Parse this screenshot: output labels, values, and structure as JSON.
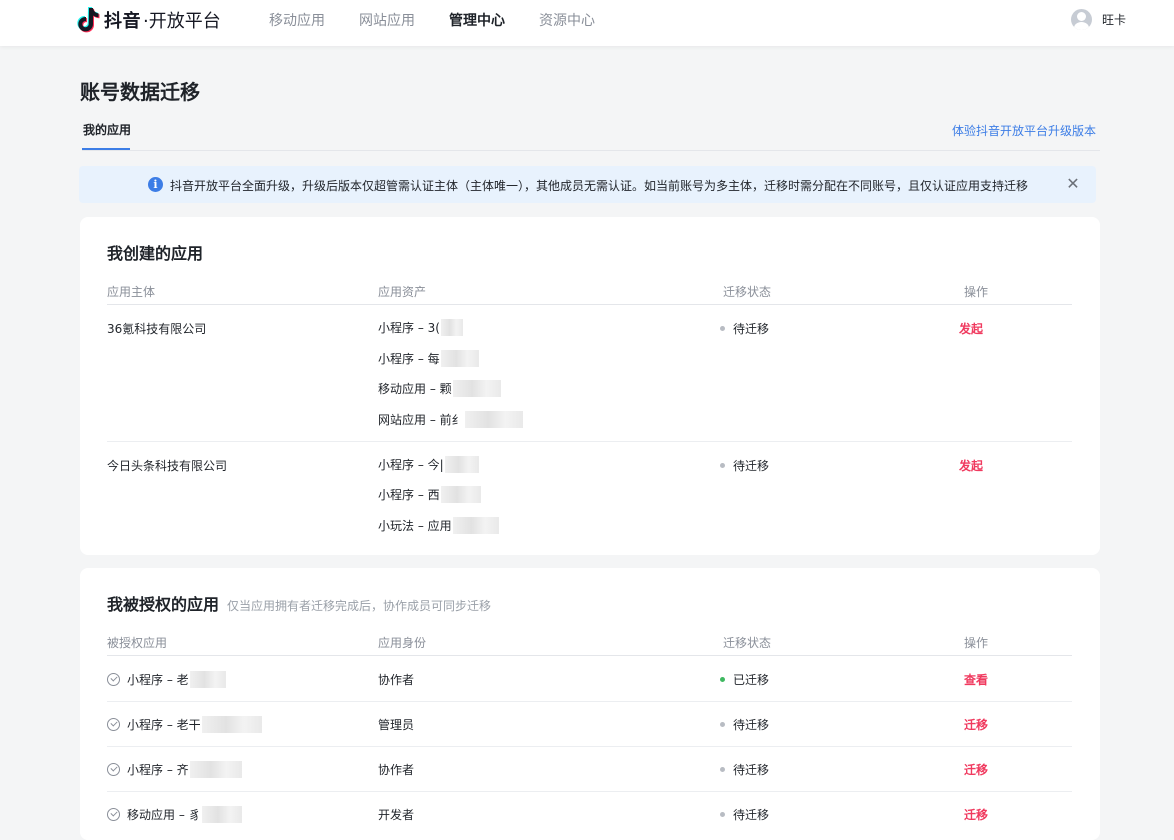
{
  "header": {
    "brand": "抖音",
    "brand_sub": "·开放平台",
    "nav": [
      {
        "label": "移动应用",
        "active": false
      },
      {
        "label": "网站应用",
        "active": false
      },
      {
        "label": "管理中心",
        "active": true
      },
      {
        "label": "资源中心",
        "active": false
      }
    ],
    "user_name": "旺卡"
  },
  "page": {
    "title": "账号数据迁移",
    "tab": "我的应用",
    "upgrade_link": "体验抖音开放平台升级版本"
  },
  "notice": {
    "text": "抖音开放平台全面升级，升级后版本仅超管需认证主体（主体唯一），其他成员无需认证。如当前账号为多主体，迁移时需分配在不同账号，且仅认证应用支持迁移"
  },
  "created": {
    "title": "我创建的应用",
    "headers": [
      "应用主体",
      "应用资产",
      "迁移状态",
      "操作"
    ],
    "rows": [
      {
        "entity": "36氪科技有限公司",
        "assets": [
          "小程序 – 3(",
          "小程序 – 每",
          "移动应用 – 颗",
          "网站应用 – 前纟"
        ],
        "status": "待迁移",
        "action": "发起"
      },
      {
        "entity": "今日头条科技有限公司",
        "assets": [
          "小程序 – 今|",
          "小程序 – 西",
          "小玩法 – 应用"
        ],
        "status": "待迁移",
        "action": "发起"
      }
    ]
  },
  "authorized": {
    "title": "我被授权的应用",
    "subtitle": "仅当应用拥有者迁移完成后，协作成员可同步迁移",
    "headers": [
      "被授权应用",
      "应用身份",
      "迁移状态",
      "操作"
    ],
    "rows": [
      {
        "app": "小程序 – 老",
        "role": "协作者",
        "status": "已迁移",
        "action": "查看"
      },
      {
        "app": "小程序 – 老干",
        "role": "管理员",
        "status": "待迁移",
        "action": "迁移"
      },
      {
        "app": "小程序 – 齐",
        "role": "协作者",
        "status": "待迁移",
        "action": "迁移"
      },
      {
        "app": "移动应用 – 豸",
        "role": "开发者",
        "status": "待迁移",
        "action": "迁移"
      }
    ]
  },
  "colors": {
    "accent_blue": "#3c7de6",
    "action_red": "#f03a5f",
    "done_green": "#3fb861",
    "pending_gray": "#b8bcc3"
  }
}
